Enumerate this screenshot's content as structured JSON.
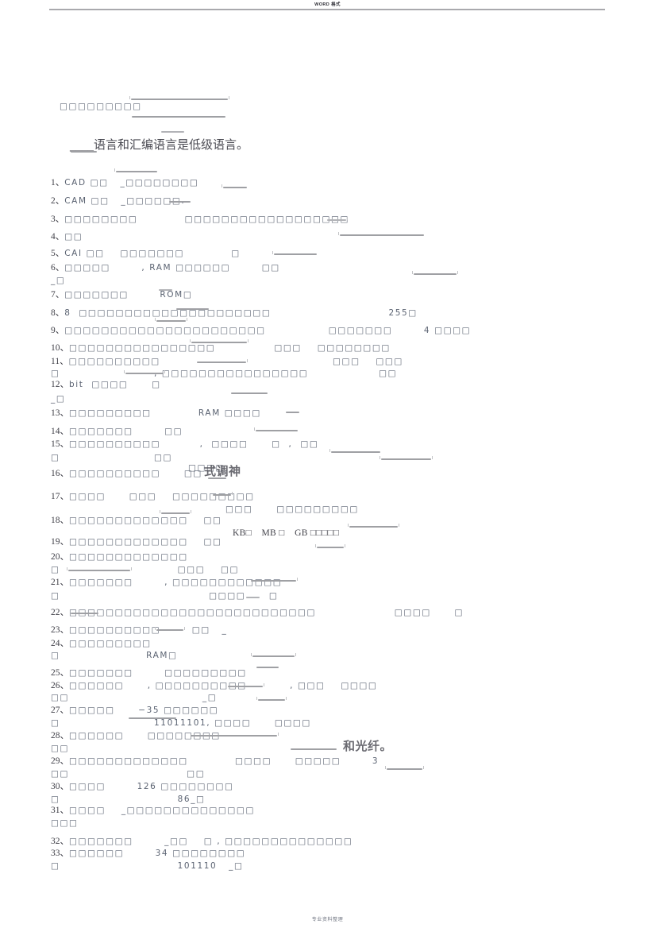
{
  "document": {
    "header_text": "WORD 格式",
    "footer_text": "专业资料整理",
    "title_line": "____语言和汇编语言是低级语言。",
    "intro_boxes": "□□□□□□□□□"
  },
  "items": [
    {
      "num": "1、",
      "text": "CAD □□   _□□□□□□□□"
    },
    {
      "num": "2、",
      "text": "CAM □□   _□□□□□□."
    },
    {
      "num": "3、",
      "text": "□□□□□□□□            □□□□□□□□□□□□□□□□□□"
    },
    {
      "num": "4、",
      "text": "□□"
    },
    {
      "num": "5、",
      "text": "CAI □□    □□□□□□□            □"
    },
    {
      "num": "6、",
      "text": "□□□□□        , RAM □□□□□□        □□"
    },
    {
      "num": "6b",
      "text": "_□"
    },
    {
      "num": "7、",
      "text": "□□□□□□□        ROM□"
    },
    {
      "num": "8、",
      "text": "8  □□□□□□□□□□□□□□□□□□□□□                              255□"
    },
    {
      "num": "9、",
      "text": "□□□□□□□□□□□□□□□□□□□□□□                □□□□□□□        4 □□□□"
    },
    {
      "num": "10、",
      "text": "□□□□□□□□□□□□□□□□               □□□    □□□□□□□□"
    },
    {
      "num": "11、",
      "text": "□□□□□□□□□□                                            □□□    □□□"
    },
    {
      "num": "11b",
      "text": "□                        , □□□□□□□□□□□□□□□□                  □□"
    },
    {
      "num": "12、",
      "text": "bit  □□□□      □"
    },
    {
      "num": "12b",
      "text": "_□"
    },
    {
      "num": "13、",
      "text": "□□□□□□□□□            RAM □□□□"
    },
    {
      "num": "14、",
      "text": "□□□□□□□        □□"
    },
    {
      "num": "15、",
      "text": "□□□□□□□□□□          ,  □□□□      □  ,  □□"
    },
    {
      "num": "15b",
      "text": "□                        □□"
    },
    {
      "num": "15c",
      "text": "□□□□"
    },
    {
      "num": "16、",
      "text": "□□□□□□□□□□      □□"
    },
    {
      "num": "17、",
      "text": "□□□□      □□□    □□□□□□□□□"
    },
    {
      "num": "17b",
      "text": "□□□      □□□□□□□□□"
    },
    {
      "num": "18、",
      "text": "□□□□□□□□□□□□□    □□"
    },
    {
      "num": "18b",
      "text": "KB□    MB □    GB □□□□□"
    },
    {
      "num": "19、",
      "text": "□□□□□□□□□□□□□    □□"
    },
    {
      "num": "20、",
      "text": "□□□□□□□□□□□□□"
    },
    {
      "num": "20b",
      "text": "□                              □□□    □□"
    },
    {
      "num": "21、",
      "text": "□□□□□□□        , □□□□□□□□□□□□"
    },
    {
      "num": "21b",
      "text": "□                                      □□□□      □"
    },
    {
      "num": "22、",
      "text": "□□□□□□□□□□□□□□□□□□□□□□□□□□□                    □□□□      □"
    },
    {
      "num": "23、",
      "text": "□□□□□□□□□□        □□   _"
    },
    {
      "num": "24、",
      "text": "□□□□□□□□□"
    },
    {
      "num": "24b",
      "text": "□                      RAM□"
    },
    {
      "num": "25、",
      "text": "□□□□□□□        □□□□□□□□□"
    },
    {
      "num": "26、",
      "text": "□□□□□□      , □□□□□□□□□□           , □□□    □□□□"
    },
    {
      "num": "26b",
      "text": "□□                                  _□"
    },
    {
      "num": "27、",
      "text": "□□□□□      −35 □□□□□□"
    },
    {
      "num": "27b",
      "text": "□                        11011101, □□□□      □□□□"
    },
    {
      "num": "28、",
      "text": "□□□□□□      □□□□□□□□"
    },
    {
      "num": "28b",
      "text": "□□"
    },
    {
      "num": "29、",
      "text": "□□□□□□□□□□□□□            □□□□      □□□□□        3"
    },
    {
      "num": "29b",
      "text": "□□                              □□"
    },
    {
      "num": "30、",
      "text": "□□□□        126 □□□□□□□□"
    },
    {
      "num": "30b",
      "text": "□                              86_□"
    },
    {
      "num": "31、",
      "text": "□□□□    _□□□□□□□□□□□□□□"
    },
    {
      "num": "31b",
      "text": "□□□"
    },
    {
      "num": "32、",
      "text": "□□□□□□□        _□□    □ , □□□□□□□□□□□□□□"
    },
    {
      "num": "33、",
      "text": "□□□□□□        34 □□□□□□□□"
    },
    {
      "num": "33b",
      "text": "□                              101110   _□"
    }
  ],
  "artifacts": {
    "cjk_fragment_1": "式调神",
    "cjk_fragment_2": "和光纤。"
  },
  "colors": {
    "page_background": "#ffffff",
    "text": "#44444c",
    "tofu_glyph": "#5b6372",
    "rule": "#a9a9ad",
    "answer_blank": "#9fa0a4"
  }
}
